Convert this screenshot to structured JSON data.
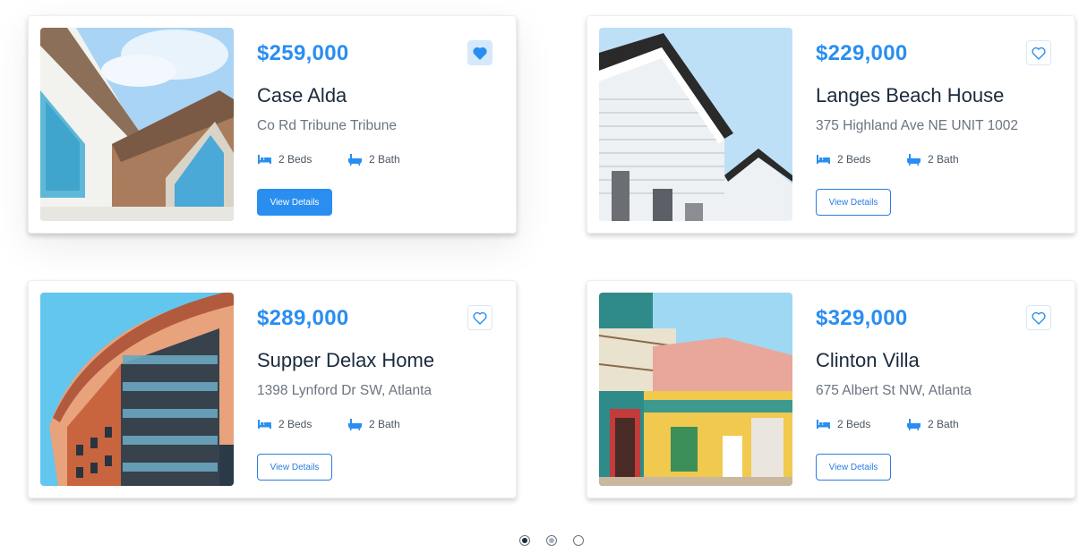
{
  "listings": [
    {
      "price": "$259,000",
      "title": "Case Alda",
      "address": "Co Rd Tribune Tribune",
      "beds": "2 Beds",
      "baths": "2 Bath",
      "button_label": "View Details",
      "favorited": true,
      "photo": "house-gable-photo"
    },
    {
      "price": "$229,000",
      "title": "Langes Beach House",
      "address": "375 Highland Ave NE UNIT 1002",
      "beds": "2 Beds",
      "baths": "2 Bath",
      "button_label": "View Details",
      "favorited": false,
      "photo": "white-siding-house-photo"
    },
    {
      "price": "$289,000",
      "title": "Supper Delax Home",
      "address": "1398 Lynford Dr SW, Atlanta",
      "beds": "2 Beds",
      "baths": "2 Bath",
      "button_label": "View Details",
      "favorited": false,
      "photo": "modern-building-photo"
    },
    {
      "price": "$329,000",
      "title": "Clinton Villa",
      "address": "675 Albert St NW, Atlanta",
      "beds": "2 Beds",
      "baths": "2 Bath",
      "button_label": "View Details",
      "favorited": false,
      "photo": "colorful-villa-photo"
    }
  ],
  "pagination": {
    "pages": 3,
    "current": 1
  },
  "icons": {
    "beds": "bed-icon",
    "baths": "bathtub-icon",
    "favorite": "heart-icon"
  },
  "colors": {
    "accent": "#2a8ef0",
    "title": "#1a2b3c",
    "muted": "#6b7480"
  }
}
